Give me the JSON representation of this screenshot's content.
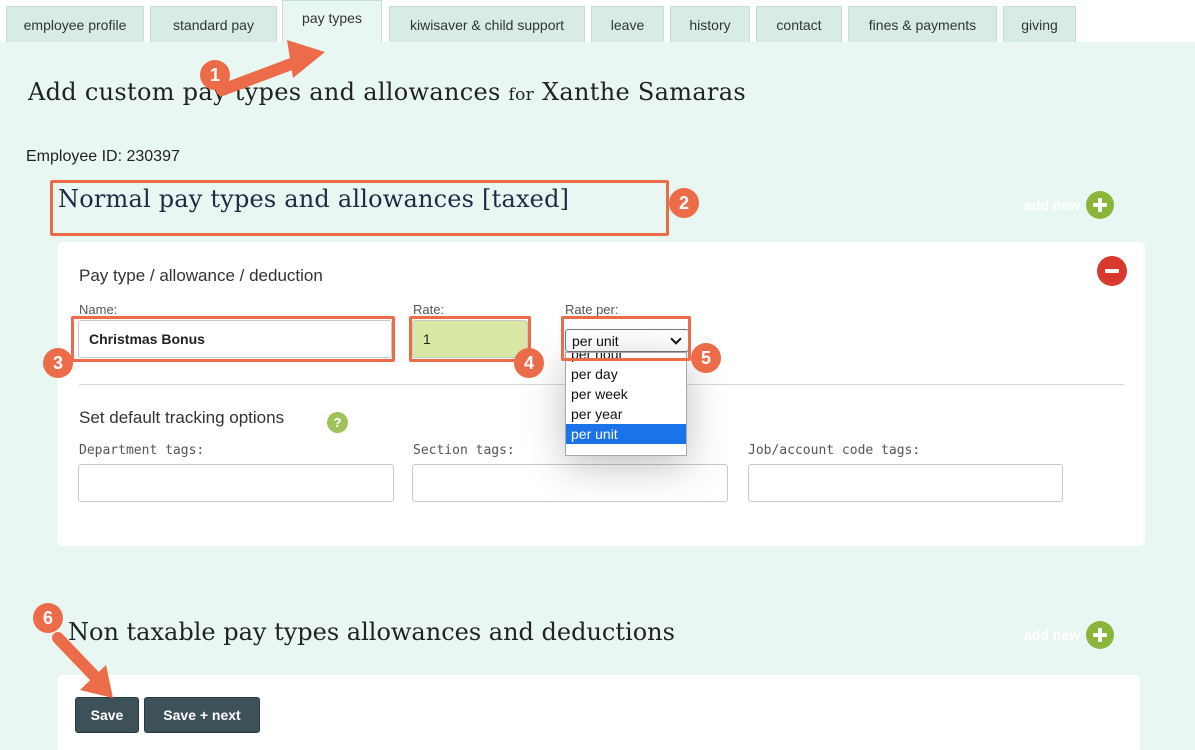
{
  "tabs": [
    {
      "label": "employee profile"
    },
    {
      "label": "standard pay"
    },
    {
      "label": "pay types"
    },
    {
      "label": "kiwisaver & child support"
    },
    {
      "label": "leave"
    },
    {
      "label": "history"
    },
    {
      "label": "contact"
    },
    {
      "label": "fines & payments"
    },
    {
      "label": "giving"
    }
  ],
  "page": {
    "title": "Add custom pay types and allowances",
    "title_for": "for",
    "employee_name": "Xanthe Samaras",
    "employee_id": "Employee ID: 230397"
  },
  "taxed_section": {
    "title": "Normal pay types and allowances [taxed]",
    "add_new": "add new"
  },
  "card": {
    "heading": "Pay type / allowance / deduction",
    "name_label": "Name:",
    "name_value": "Christmas Bonus",
    "rate_label": "Rate:",
    "rate_value": "1",
    "rate_per_label": "Rate per:",
    "rate_per_selected": "per unit",
    "rate_per_options": [
      "per hour",
      "per day",
      "per week",
      "per year",
      "per unit"
    ],
    "tracking_title": "Set default tracking options",
    "help_glyph": "?",
    "department_label": "Department tags:",
    "section_label": "Section tags:",
    "job_label": "Job/account code tags:"
  },
  "nontax_section": {
    "title": "Non taxable pay types allowances and deductions",
    "add_new": "add new"
  },
  "buttons": {
    "save": "Save",
    "save_next": "Save + next"
  },
  "annotations": [
    "1",
    "2",
    "3",
    "4",
    "5",
    "6"
  ],
  "colors": {
    "panel_bg": "#e9f7f2",
    "tab_bg": "#d7ede4",
    "rate_bg": "#d9e8a4",
    "add_green": "#8ab43a",
    "remove_red": "#d9382f",
    "button_dark": "#3d5158",
    "annotation_orange": "#ec6c4a",
    "select_highlight": "#1a73e8"
  },
  "icons": {
    "add": "plus-circle-icon",
    "remove": "minus-circle-icon",
    "help": "question-circle-icon",
    "dropdown": "chevron-down-icon"
  }
}
